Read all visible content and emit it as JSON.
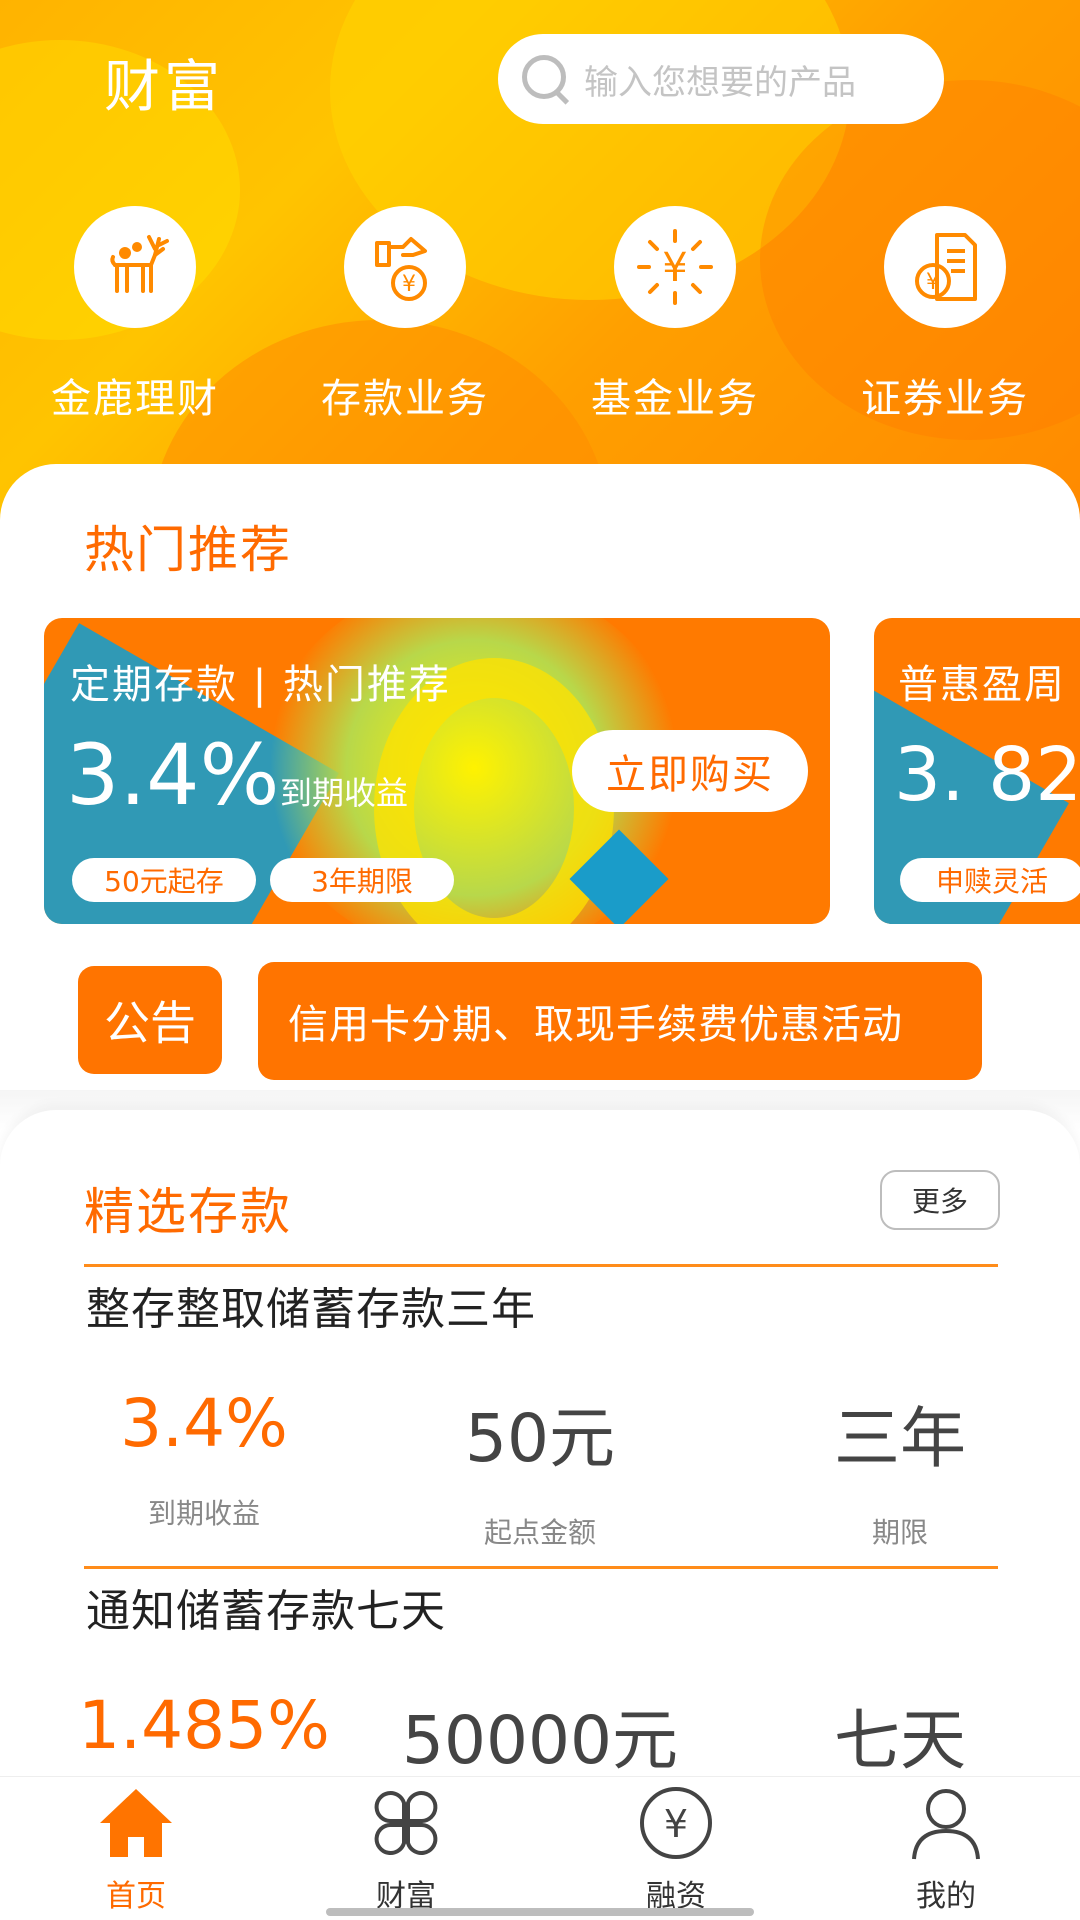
{
  "header": {
    "title": "财富",
    "search_placeholder": "输入您想要的产品"
  },
  "quick_actions": [
    {
      "label": "金鹿理财",
      "icon": "golden-deer-icon"
    },
    {
      "label": "存款业务",
      "icon": "piggy-bank-icon"
    },
    {
      "label": "基金业务",
      "icon": "yuan-sun-icon"
    },
    {
      "label": "证券业务",
      "icon": "securities-document-icon"
    }
  ],
  "hot": {
    "title": "热门推荐",
    "banners": [
      {
        "heading": "定期存款 | 热门推荐",
        "rate": "3.4%",
        "rate_label": "到期收益",
        "tags": [
          "50元起存",
          "3年期限"
        ],
        "buy_label": "立即购买"
      },
      {
        "heading": "普惠盈周",
        "rate": "3. 82",
        "tags": [
          "申赎灵活"
        ]
      }
    ]
  },
  "notice": {
    "badge": "公告",
    "text": "信用卡分期、取现手续费优惠活动"
  },
  "deposits": {
    "title": "精选存款",
    "more_label": "更多",
    "products": [
      {
        "name": "整存整取储蓄存款三年",
        "stats": [
          {
            "value": "3.4%",
            "label": "到期收益"
          },
          {
            "value": "50元",
            "label": "起点金额"
          },
          {
            "value": "三年",
            "label": "期限"
          }
        ]
      },
      {
        "name": "通知储蓄存款七天",
        "stats": [
          {
            "value": "1.485%"
          },
          {
            "value": "50000元"
          },
          {
            "value": "七天"
          }
        ]
      }
    ]
  },
  "tabbar": {
    "items": [
      {
        "label": "首页",
        "icon": "home-icon",
        "active": true
      },
      {
        "label": "财富",
        "icon": "clover-grid-icon",
        "active": false
      },
      {
        "label": "融资",
        "icon": "yuan-circle-icon",
        "active": false
      },
      {
        "label": "我的",
        "icon": "user-icon",
        "active": false
      }
    ]
  },
  "colors": {
    "accent": "#ff6a00",
    "header_gradient": [
      "#ffb300",
      "#ff8a00"
    ],
    "banner_blue": "#1a9cc9"
  }
}
